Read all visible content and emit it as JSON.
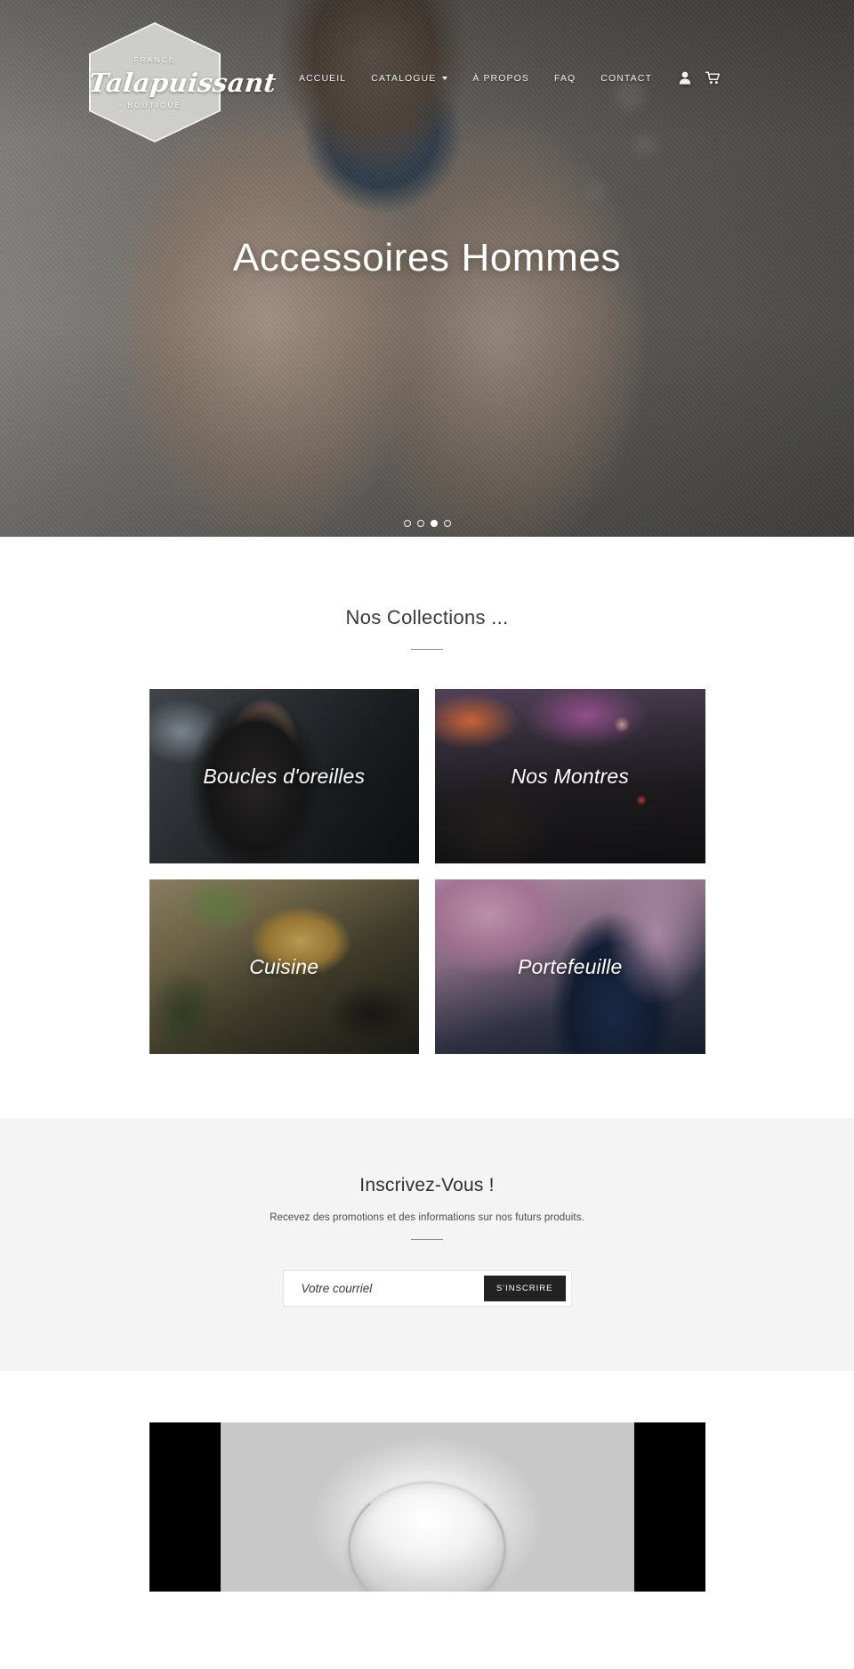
{
  "site": {
    "logo": {
      "top_text": "· FRANCE ·",
      "name": "Talapuissant",
      "bottom_text": "· BOUTIQUE ·"
    },
    "nav": [
      {
        "label": "ACCUEIL",
        "has_dropdown": false
      },
      {
        "label": "CATALOGUE",
        "has_dropdown": true
      },
      {
        "label": "À PROPOS",
        "has_dropdown": false
      },
      {
        "label": "FAQ",
        "has_dropdown": false
      },
      {
        "label": "CONTACT",
        "has_dropdown": false
      }
    ],
    "icons": {
      "account": "account-person-icon",
      "cart": "shopping-cart-icon"
    }
  },
  "hero": {
    "title": "Accessoires Hommes",
    "slides_total": 4,
    "active_slide": 3
  },
  "collections": {
    "title": "Nos Collections ...",
    "cards": [
      {
        "label": "Boucles d'oreilles",
        "art": "art-earrings"
      },
      {
        "label": "Nos Montres",
        "art": "art-watch"
      },
      {
        "label": "Cuisine",
        "art": "art-cuisine"
      },
      {
        "label": "Portefeuille",
        "art": "art-wallet"
      }
    ]
  },
  "newsletter": {
    "title": "Inscrivez-Vous !",
    "subtitle": "Recevez des promotions et des informations sur nos futurs produits.",
    "email_placeholder": "Votre courriel",
    "email_value": "",
    "submit_label": "S'INSCRIRE"
  },
  "colors": {
    "accent_dark": "#222222",
    "page_bg": "#ffffff",
    "newsletter_bg": "#f4f4f4",
    "text": "#2b2b2b"
  }
}
